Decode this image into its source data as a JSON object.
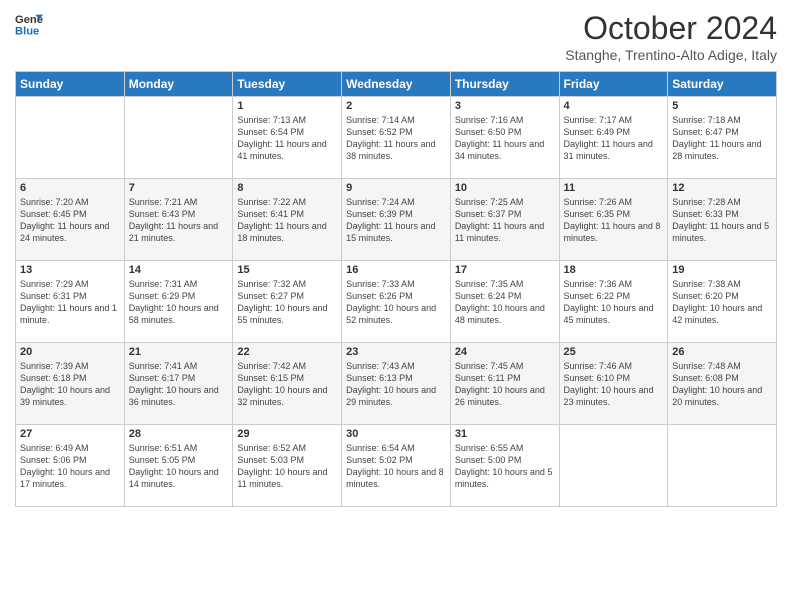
{
  "header": {
    "logo_line1": "General",
    "logo_line2": "Blue",
    "month_title": "October 2024",
    "subtitle": "Stanghe, Trentino-Alto Adige, Italy"
  },
  "days_of_week": [
    "Sunday",
    "Monday",
    "Tuesday",
    "Wednesday",
    "Thursday",
    "Friday",
    "Saturday"
  ],
  "weeks": [
    [
      {
        "day": "",
        "info": ""
      },
      {
        "day": "",
        "info": ""
      },
      {
        "day": "1",
        "info": "Sunrise: 7:13 AM\nSunset: 6:54 PM\nDaylight: 11 hours and 41 minutes."
      },
      {
        "day": "2",
        "info": "Sunrise: 7:14 AM\nSunset: 6:52 PM\nDaylight: 11 hours and 38 minutes."
      },
      {
        "day": "3",
        "info": "Sunrise: 7:16 AM\nSunset: 6:50 PM\nDaylight: 11 hours and 34 minutes."
      },
      {
        "day": "4",
        "info": "Sunrise: 7:17 AM\nSunset: 6:49 PM\nDaylight: 11 hours and 31 minutes."
      },
      {
        "day": "5",
        "info": "Sunrise: 7:18 AM\nSunset: 6:47 PM\nDaylight: 11 hours and 28 minutes."
      }
    ],
    [
      {
        "day": "6",
        "info": "Sunrise: 7:20 AM\nSunset: 6:45 PM\nDaylight: 11 hours and 24 minutes."
      },
      {
        "day": "7",
        "info": "Sunrise: 7:21 AM\nSunset: 6:43 PM\nDaylight: 11 hours and 21 minutes."
      },
      {
        "day": "8",
        "info": "Sunrise: 7:22 AM\nSunset: 6:41 PM\nDaylight: 11 hours and 18 minutes."
      },
      {
        "day": "9",
        "info": "Sunrise: 7:24 AM\nSunset: 6:39 PM\nDaylight: 11 hours and 15 minutes."
      },
      {
        "day": "10",
        "info": "Sunrise: 7:25 AM\nSunset: 6:37 PM\nDaylight: 11 hours and 11 minutes."
      },
      {
        "day": "11",
        "info": "Sunrise: 7:26 AM\nSunset: 6:35 PM\nDaylight: 11 hours and 8 minutes."
      },
      {
        "day": "12",
        "info": "Sunrise: 7:28 AM\nSunset: 6:33 PM\nDaylight: 11 hours and 5 minutes."
      }
    ],
    [
      {
        "day": "13",
        "info": "Sunrise: 7:29 AM\nSunset: 6:31 PM\nDaylight: 11 hours and 1 minute."
      },
      {
        "day": "14",
        "info": "Sunrise: 7:31 AM\nSunset: 6:29 PM\nDaylight: 10 hours and 58 minutes."
      },
      {
        "day": "15",
        "info": "Sunrise: 7:32 AM\nSunset: 6:27 PM\nDaylight: 10 hours and 55 minutes."
      },
      {
        "day": "16",
        "info": "Sunrise: 7:33 AM\nSunset: 6:26 PM\nDaylight: 10 hours and 52 minutes."
      },
      {
        "day": "17",
        "info": "Sunrise: 7:35 AM\nSunset: 6:24 PM\nDaylight: 10 hours and 48 minutes."
      },
      {
        "day": "18",
        "info": "Sunrise: 7:36 AM\nSunset: 6:22 PM\nDaylight: 10 hours and 45 minutes."
      },
      {
        "day": "19",
        "info": "Sunrise: 7:38 AM\nSunset: 6:20 PM\nDaylight: 10 hours and 42 minutes."
      }
    ],
    [
      {
        "day": "20",
        "info": "Sunrise: 7:39 AM\nSunset: 6:18 PM\nDaylight: 10 hours and 39 minutes."
      },
      {
        "day": "21",
        "info": "Sunrise: 7:41 AM\nSunset: 6:17 PM\nDaylight: 10 hours and 36 minutes."
      },
      {
        "day": "22",
        "info": "Sunrise: 7:42 AM\nSunset: 6:15 PM\nDaylight: 10 hours and 32 minutes."
      },
      {
        "day": "23",
        "info": "Sunrise: 7:43 AM\nSunset: 6:13 PM\nDaylight: 10 hours and 29 minutes."
      },
      {
        "day": "24",
        "info": "Sunrise: 7:45 AM\nSunset: 6:11 PM\nDaylight: 10 hours and 26 minutes."
      },
      {
        "day": "25",
        "info": "Sunrise: 7:46 AM\nSunset: 6:10 PM\nDaylight: 10 hours and 23 minutes."
      },
      {
        "day": "26",
        "info": "Sunrise: 7:48 AM\nSunset: 6:08 PM\nDaylight: 10 hours and 20 minutes."
      }
    ],
    [
      {
        "day": "27",
        "info": "Sunrise: 6:49 AM\nSunset: 5:06 PM\nDaylight: 10 hours and 17 minutes."
      },
      {
        "day": "28",
        "info": "Sunrise: 6:51 AM\nSunset: 5:05 PM\nDaylight: 10 hours and 14 minutes."
      },
      {
        "day": "29",
        "info": "Sunrise: 6:52 AM\nSunset: 5:03 PM\nDaylight: 10 hours and 11 minutes."
      },
      {
        "day": "30",
        "info": "Sunrise: 6:54 AM\nSunset: 5:02 PM\nDaylight: 10 hours and 8 minutes."
      },
      {
        "day": "31",
        "info": "Sunrise: 6:55 AM\nSunset: 5:00 PM\nDaylight: 10 hours and 5 minutes."
      },
      {
        "day": "",
        "info": ""
      },
      {
        "day": "",
        "info": ""
      }
    ]
  ]
}
